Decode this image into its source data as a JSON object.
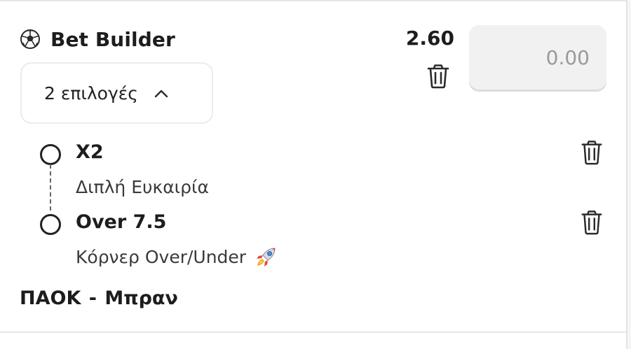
{
  "bet": {
    "title": "Bet Builder",
    "odds": "2.60",
    "stake_placeholder": "0.00",
    "selections_toggle": "2 επιλογές",
    "match": "ΠΑΟΚ - Μπραν"
  },
  "legs": [
    {
      "name": "X2",
      "market": "Διπλή Ευκαιρία"
    },
    {
      "name": "Over 7.5",
      "market": "Κόρνερ Over/Under"
    }
  ],
  "icons": {
    "title_icon": "soccer-ball-icon",
    "trash": "trash-icon",
    "chevron": "chevron-up-icon",
    "market_badge": "rocket-icon"
  },
  "colors": {
    "text": "#1d1d1d",
    "input_bg": "#f1f1f1",
    "divider": "#e6e6e6"
  }
}
